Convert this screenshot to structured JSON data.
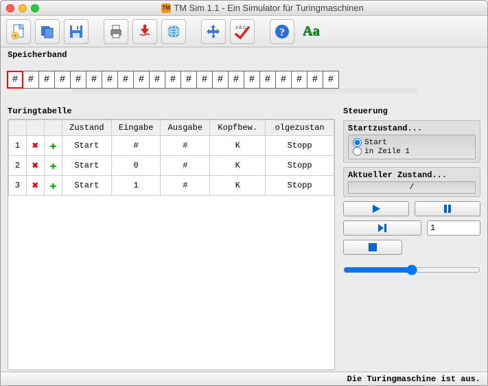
{
  "window": {
    "title": "TM Sim 1.1 - Ein Simulator für Turingmaschinen",
    "badge": "TM"
  },
  "sections": {
    "tape_label": "Speicherband",
    "table_label": "Turingtabelle",
    "control_label": "Steuerung"
  },
  "tape": {
    "head_index": 0,
    "cells": [
      "#",
      "#",
      "#",
      "#",
      "#",
      "#",
      "#",
      "#",
      "#",
      "#",
      "#",
      "#",
      "#",
      "#",
      "#",
      "#",
      "#",
      "#",
      "#",
      "#",
      "#"
    ]
  },
  "table": {
    "headers": [
      "",
      "",
      "",
      "Zustand",
      "Eingabe",
      "Ausgabe",
      "Kopfbew.",
      "olgezustan"
    ],
    "rows": [
      {
        "n": "1",
        "zustand": "Start",
        "eingabe": "#",
        "ausgabe": "#",
        "kopf": "K",
        "folge": "Stopp"
      },
      {
        "n": "2",
        "zustand": "Start",
        "eingabe": "0",
        "ausgabe": "#",
        "kopf": "K",
        "folge": "Stopp"
      },
      {
        "n": "3",
        "zustand": "Start",
        "eingabe": "1",
        "ausgabe": "#",
        "kopf": "K",
        "folge": "Stopp"
      }
    ]
  },
  "control": {
    "start_label": "Startzustand...",
    "start_option_a": "Start",
    "start_option_b": "in Zeile 1",
    "current_label": "Aktueller Zustand...",
    "current_value": "/",
    "step_value": "1"
  },
  "status": "Die Turingmaschine ist aus.",
  "icons": {
    "new": "new-file-icon",
    "open": "open-icon",
    "save": "save-icon",
    "print": "print-icon",
    "pdf": "pdf-icon",
    "web": "web-icon",
    "move": "move-icon",
    "check": "check-icon",
    "help": "help-icon",
    "font": "font-icon"
  }
}
